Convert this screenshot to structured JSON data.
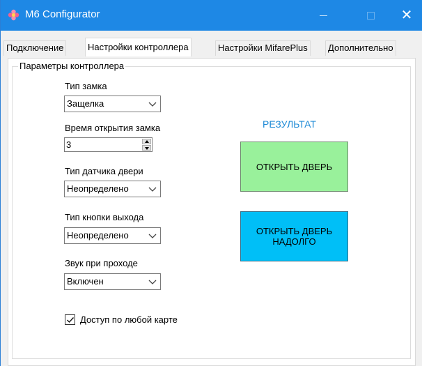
{
  "window": {
    "title": "M6 Configurator",
    "close_symbol": "✕",
    "icon": "flower-icon"
  },
  "tabs": [
    {
      "label": "Подключение",
      "active": false
    },
    {
      "label": "Настройки контроллера",
      "active": true
    },
    {
      "label": "Настройки MifarePlus",
      "active": false
    },
    {
      "label": "Дополнительно",
      "active": false
    }
  ],
  "group": {
    "legend": "Параметры контроллера"
  },
  "settings": {
    "lock_type": {
      "label": "Тип замка",
      "value": "Защелка"
    },
    "lock_open_time": {
      "label": "Время открытия замка",
      "value": "3"
    },
    "door_sensor_type": {
      "label": "Тип датчика двери",
      "value": "Неопределено"
    },
    "exit_button_type": {
      "label": "Тип кнопки выхода",
      "value": "Неопределено"
    },
    "pass_sound": {
      "label": "Звук при проходе",
      "value": "Включен"
    },
    "any_card_access": {
      "label": "Доступ по любой карте",
      "checked": true
    }
  },
  "result": {
    "label": "РЕЗУЛЬТАТ"
  },
  "actions": {
    "open_door": "ОТКРЫТЬ ДВЕРЬ",
    "open_door_long_line1": "ОТКРЫТЬ ДВЕРЬ",
    "open_door_long_line2": "НАДОЛГО"
  },
  "colors": {
    "titlebar": "#1e88e5",
    "result_text": "#1e8ad6",
    "open_door_button": "#99f19b",
    "open_door_long_button": "#00bff7"
  }
}
